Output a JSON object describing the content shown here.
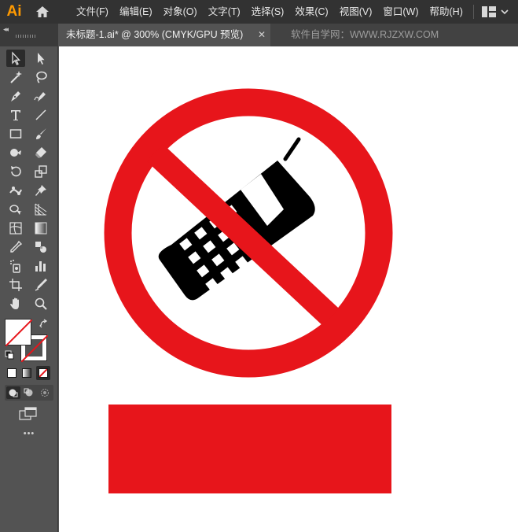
{
  "app": {
    "logo_text": "Ai"
  },
  "menu": {
    "items": [
      {
        "label": "文件(F)",
        "name": "menu-file"
      },
      {
        "label": "编辑(E)",
        "name": "menu-edit"
      },
      {
        "label": "对象(O)",
        "name": "menu-object"
      },
      {
        "label": "文字(T)",
        "name": "menu-type"
      },
      {
        "label": "选择(S)",
        "name": "menu-select"
      },
      {
        "label": "效果(C)",
        "name": "menu-effect"
      },
      {
        "label": "视图(V)",
        "name": "menu-view"
      },
      {
        "label": "窗口(W)",
        "name": "menu-window"
      },
      {
        "label": "帮助(H)",
        "name": "menu-help"
      }
    ],
    "workspace_icon": "workspace-switcher-icon"
  },
  "tabs": {
    "collapse_label": "◂◂",
    "document_tab": "未标题-1.ai* @ 300% (CMYK/GPU 预览)",
    "close_label": "✕",
    "watermark": "软件自学网：WWW.RJZXW.COM"
  },
  "toolbar": {
    "more_label": "•••",
    "tools": [
      "selection-tool-icon",
      "direct-selection-tool-icon",
      "magic-wand-tool-icon",
      "lasso-tool-icon",
      "pen-tool-icon",
      "curvature-tool-icon",
      "type-tool-icon",
      "line-segment-tool-icon",
      "rectangle-tool-icon",
      "paintbrush-tool-icon",
      "shaper-tool-icon",
      "eraser-tool-icon",
      "rotate-tool-icon",
      "scale-tool-icon",
      "puppet-warp-tool-icon",
      "pin-tool-icon",
      "shape-builder-tool-icon",
      "perspective-grid-tool-icon",
      "mesh-tool-icon",
      "gradient-tool-icon",
      "eyedropper-tool-icon",
      "blend-tool-icon",
      "symbol-sprayer-tool-icon",
      "column-graph-tool-icon",
      "artboard-tool-icon",
      "slice-tool-icon",
      "hand-tool-icon",
      "zoom-tool-icon"
    ]
  },
  "artwork": {
    "sign_color": "#e7151b",
    "phone_color": "#000000"
  }
}
